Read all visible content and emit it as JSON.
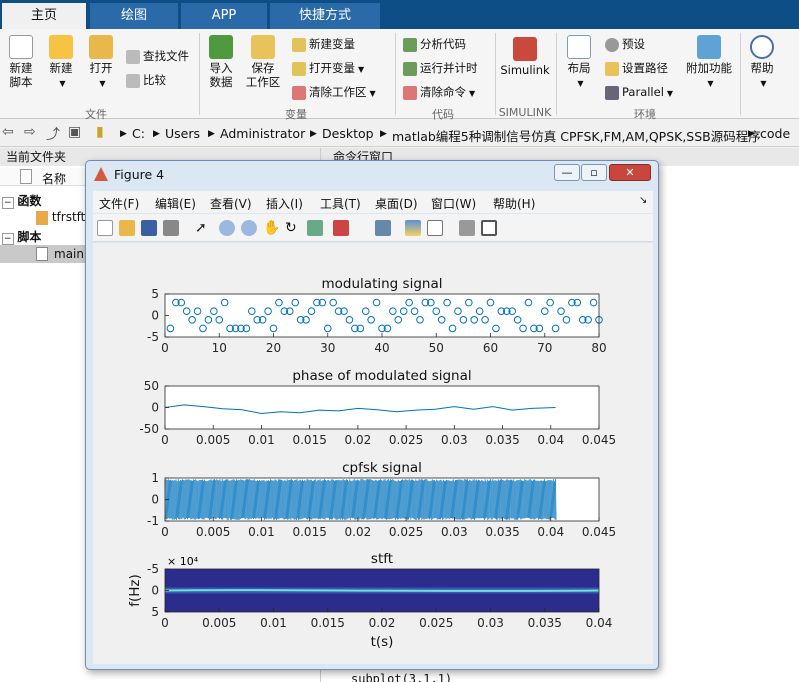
{
  "tabs": [
    {
      "label": "主页",
      "active": true
    },
    {
      "label": "绘图",
      "active": false
    },
    {
      "label": "APP",
      "active": false
    },
    {
      "label": "快捷方式",
      "active": false
    }
  ],
  "ribbon": {
    "new_script": "新建\n脚本",
    "new": "新建",
    "open": "打开",
    "find_files": "查找文件",
    "compare": "比较",
    "import_data": "导入\n数据",
    "save_workspace": "保存\n工作区",
    "new_variable": "新建变量",
    "open_variable": "打开变量",
    "clear_workspace": "清除工作区",
    "analyze_code": "分析代码",
    "run_and_time": "运行并计时",
    "clear_commands": "清除命令",
    "simulink": "Simulink",
    "layout": "布局",
    "preferences": "预设",
    "set_path": "设置路径",
    "parallel": "Parallel",
    "addons": "附加功能",
    "help": "帮助",
    "groups": {
      "file": "文件",
      "variable": "变量",
      "code": "代码",
      "simulink": "SIMULINK",
      "environment": "环境"
    }
  },
  "address": [
    "C:",
    "Users",
    "Administrator",
    "Desktop",
    "matlab编程5种调制信号仿真 CPFSK,FM,AM,QPSK,SSB源码程序",
    "code"
  ],
  "left_panel": {
    "header": "当前文件夹",
    "col_name": "名称",
    "groups": [
      {
        "label": "函数",
        "files": [
          "tfrstft"
        ]
      },
      {
        "label": "脚本",
        "files": [
          "main"
        ]
      }
    ]
  },
  "cmd_panel": {
    "header": "命令行窗口",
    "bottom_line": "subplot(3,1,1)"
  },
  "figure": {
    "title": "Figure 4",
    "menus": [
      "文件(F)",
      "编辑(E)",
      "查看(V)",
      "插入(I)",
      "工具(T)",
      "桌面(D)",
      "窗口(W)",
      "帮助(H)"
    ]
  },
  "chart_data": [
    {
      "type": "scatter",
      "title": "modulating signal",
      "xlim": [
        0,
        80
      ],
      "ylim": [
        -5,
        5
      ],
      "xticks": [
        0,
        10,
        20,
        30,
        40,
        50,
        60,
        70,
        80
      ],
      "yticks": [
        5,
        0,
        -5
      ],
      "x": [
        1,
        2,
        3,
        4,
        5,
        6,
        7,
        8,
        9,
        10,
        11,
        12,
        13,
        14,
        15,
        16,
        17,
        18,
        19,
        20,
        21,
        22,
        23,
        24,
        25,
        26,
        27,
        28,
        29,
        30,
        31,
        32,
        33,
        34,
        35,
        36,
        37,
        38,
        39,
        40,
        41,
        42,
        43,
        44,
        45,
        46,
        47,
        48,
        49,
        50,
        51,
        52,
        53,
        54,
        55,
        56,
        57,
        58,
        59,
        60,
        61,
        62,
        63,
        64,
        65,
        66,
        67,
        68,
        69,
        70,
        71,
        72,
        73,
        74,
        75,
        76,
        77,
        78,
        79,
        80
      ],
      "y": [
        -3,
        3,
        3,
        1,
        -1,
        1,
        -3,
        -1,
        1,
        -1,
        3,
        -3,
        -3,
        -3,
        -3,
        1,
        -1,
        -1,
        1,
        -3,
        3,
        1,
        1,
        3,
        -1,
        -1,
        1,
        3,
        3,
        -3,
        3,
        1,
        1,
        -1,
        -3,
        -3,
        1,
        -1,
        3,
        -3,
        -3,
        1,
        -1,
        1,
        3,
        1,
        -1,
        3,
        3,
        1,
        -1,
        3,
        -3,
        1,
        -1,
        3,
        -1,
        1,
        -1,
        3,
        -3,
        1,
        1,
        1,
        -1,
        -3,
        3,
        -3,
        -3,
        1,
        3,
        -3,
        1,
        -1,
        3,
        3,
        -1,
        -1,
        3,
        -1
      ],
      "color": "#0072bd"
    },
    {
      "type": "line",
      "title": "phase of modulated signal",
      "xlim": [
        0,
        0.045
      ],
      "ylim": [
        -50,
        50
      ],
      "xticks": [
        0,
        0.005,
        0.01,
        0.015,
        0.02,
        0.025,
        0.03,
        0.035,
        0.04,
        0.045
      ],
      "yticks": [
        50,
        0,
        -50
      ],
      "x": [
        0,
        0.002,
        0.004,
        0.006,
        0.008,
        0.01,
        0.012,
        0.014,
        0.016,
        0.018,
        0.02,
        0.022,
        0.024,
        0.026,
        0.028,
        0.03,
        0.032,
        0.034,
        0.036,
        0.038,
        0.0405
      ],
      "y": [
        0,
        6,
        2,
        -3,
        -5,
        -14,
        -10,
        -12,
        -6,
        -8,
        -2,
        -5,
        -10,
        -6,
        -4,
        2,
        -4,
        2,
        -6,
        -2,
        0
      ],
      "color": "#0072bd"
    },
    {
      "type": "area",
      "title": "cpfsk signal",
      "xlim": [
        0,
        0.045
      ],
      "ylim": [
        -1,
        1
      ],
      "xticks": [
        0,
        0.005,
        0.01,
        0.015,
        0.02,
        0.025,
        0.03,
        0.035,
        0.04,
        0.045
      ],
      "yticks": [
        1,
        0,
        -1
      ],
      "x_end": 0.0405,
      "color": "#0072bd"
    },
    {
      "type": "heatmap",
      "title": "stft",
      "xlabel": "t(s)",
      "ylabel": "f(Hz)",
      "exponent_label": "× 10⁴",
      "xlim": [
        0,
        0.04
      ],
      "ylim": [
        -5,
        5
      ],
      "xticks": [
        0,
        0.005,
        0.01,
        0.015,
        0.02,
        0.025,
        0.03,
        0.035,
        0.04
      ],
      "yticks": [
        -5,
        0,
        5
      ],
      "background": "#2b2c8c",
      "ridge_color": "#6fe3c6"
    }
  ]
}
